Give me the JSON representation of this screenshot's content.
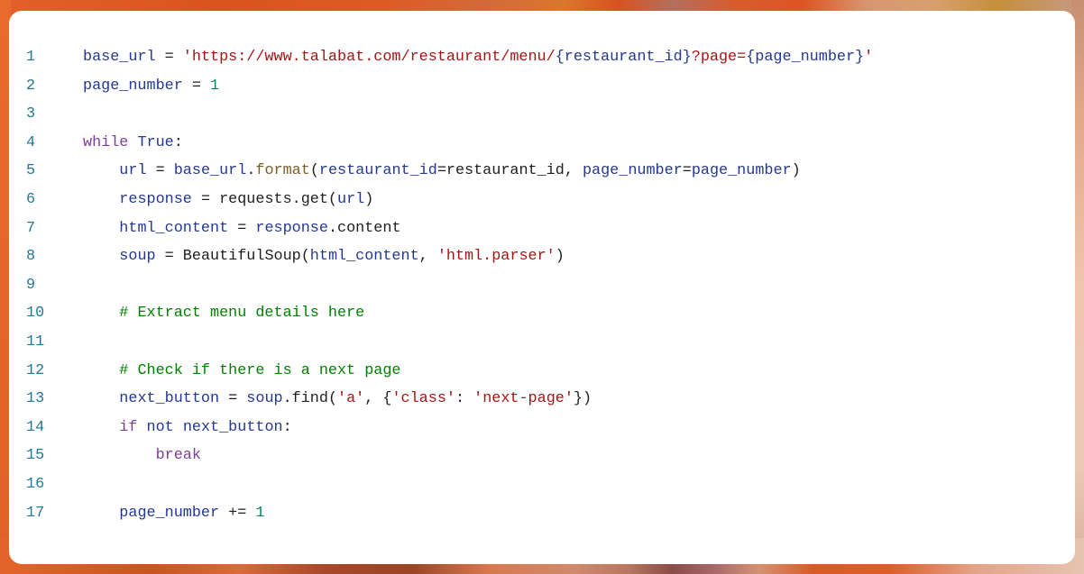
{
  "editor": {
    "language": "python",
    "lines": [
      {
        "number": "1",
        "tokens": [
          {
            "t": "base_url",
            "k": "ident"
          },
          {
            "t": " = ",
            "k": "plain"
          },
          {
            "t": "'https://www.talabat.com/restaurant/menu/",
            "k": "string"
          },
          {
            "t": "{restaurant_id}",
            "k": "ident"
          },
          {
            "t": "?page=",
            "k": "string"
          },
          {
            "t": "{page_number}",
            "k": "ident"
          },
          {
            "t": "'",
            "k": "string"
          }
        ]
      },
      {
        "number": "2",
        "tokens": [
          {
            "t": "page_number",
            "k": "ident"
          },
          {
            "t": " = ",
            "k": "plain"
          },
          {
            "t": "1",
            "k": "number"
          }
        ]
      },
      {
        "number": "3",
        "tokens": []
      },
      {
        "number": "4",
        "tokens": [
          {
            "t": "while",
            "k": "keyword"
          },
          {
            "t": " ",
            "k": "plain"
          },
          {
            "t": "True",
            "k": "const"
          },
          {
            "t": ":",
            "k": "plain"
          }
        ]
      },
      {
        "number": "5",
        "tokens": [
          {
            "t": "    ",
            "k": "plain"
          },
          {
            "t": "url",
            "k": "ident"
          },
          {
            "t": " = ",
            "k": "plain"
          },
          {
            "t": "base_url",
            "k": "ident"
          },
          {
            "t": ".",
            "k": "plain"
          },
          {
            "t": "format",
            "k": "func"
          },
          {
            "t": "(",
            "k": "plain"
          },
          {
            "t": "restaurant_id",
            "k": "ident"
          },
          {
            "t": "=restaurant_id, ",
            "k": "plain"
          },
          {
            "t": "page_number",
            "k": "ident"
          },
          {
            "t": "=",
            "k": "plain"
          },
          {
            "t": "page_number",
            "k": "ident"
          },
          {
            "t": ")",
            "k": "plain"
          }
        ]
      },
      {
        "number": "6",
        "tokens": [
          {
            "t": "    ",
            "k": "plain"
          },
          {
            "t": "response",
            "k": "ident"
          },
          {
            "t": " = requests.get(",
            "k": "plain"
          },
          {
            "t": "url",
            "k": "ident"
          },
          {
            "t": ")",
            "k": "plain"
          }
        ]
      },
      {
        "number": "7",
        "tokens": [
          {
            "t": "    ",
            "k": "plain"
          },
          {
            "t": "html_content",
            "k": "ident"
          },
          {
            "t": " = ",
            "k": "plain"
          },
          {
            "t": "response",
            "k": "ident"
          },
          {
            "t": ".content",
            "k": "plain"
          }
        ]
      },
      {
        "number": "8",
        "tokens": [
          {
            "t": "    ",
            "k": "plain"
          },
          {
            "t": "soup",
            "k": "ident"
          },
          {
            "t": " = BeautifulSoup(",
            "k": "plain"
          },
          {
            "t": "html_content",
            "k": "ident"
          },
          {
            "t": ", ",
            "k": "plain"
          },
          {
            "t": "'html.parser'",
            "k": "string"
          },
          {
            "t": ")",
            "k": "plain"
          }
        ]
      },
      {
        "number": "9",
        "tokens": []
      },
      {
        "number": "10",
        "tokens": [
          {
            "t": "    ",
            "k": "plain"
          },
          {
            "t": "# Extract menu details here",
            "k": "comment"
          }
        ]
      },
      {
        "number": "11",
        "tokens": []
      },
      {
        "number": "12",
        "tokens": [
          {
            "t": "    ",
            "k": "plain"
          },
          {
            "t": "# Check if there is a next page",
            "k": "comment"
          }
        ]
      },
      {
        "number": "13",
        "tokens": [
          {
            "t": "    ",
            "k": "plain"
          },
          {
            "t": "next_button",
            "k": "ident"
          },
          {
            "t": " = ",
            "k": "plain"
          },
          {
            "t": "soup",
            "k": "ident"
          },
          {
            "t": ".find(",
            "k": "plain"
          },
          {
            "t": "'a'",
            "k": "string"
          },
          {
            "t": ", {",
            "k": "plain"
          },
          {
            "t": "'class'",
            "k": "string"
          },
          {
            "t": ": ",
            "k": "plain"
          },
          {
            "t": "'next-page'",
            "k": "string"
          },
          {
            "t": "})",
            "k": "plain"
          }
        ]
      },
      {
        "number": "14",
        "tokens": [
          {
            "t": "    ",
            "k": "plain"
          },
          {
            "t": "if",
            "k": "keyword"
          },
          {
            "t": " ",
            "k": "plain"
          },
          {
            "t": "not",
            "k": "const"
          },
          {
            "t": " ",
            "k": "plain"
          },
          {
            "t": "next_button",
            "k": "ident"
          },
          {
            "t": ":",
            "k": "plain"
          }
        ]
      },
      {
        "number": "15",
        "tokens": [
          {
            "t": "        ",
            "k": "plain"
          },
          {
            "t": "break",
            "k": "keyword"
          }
        ]
      },
      {
        "number": "16",
        "tokens": []
      },
      {
        "number": "17",
        "tokens": [
          {
            "t": "    ",
            "k": "plain"
          },
          {
            "t": "page_number",
            "k": "ident"
          },
          {
            "t": " += ",
            "k": "plain"
          },
          {
            "t": "1",
            "k": "number"
          }
        ]
      }
    ]
  },
  "colors": {
    "line_number": "#237893",
    "identifier": "#24388f",
    "string": "#a31515",
    "number": "#098658",
    "keyword": "#7c3e9c",
    "function": "#795e26",
    "comment": "#008000",
    "plain": "#1e1e1e",
    "card_background": "#ffffff",
    "accent_background": "#e0592a"
  }
}
